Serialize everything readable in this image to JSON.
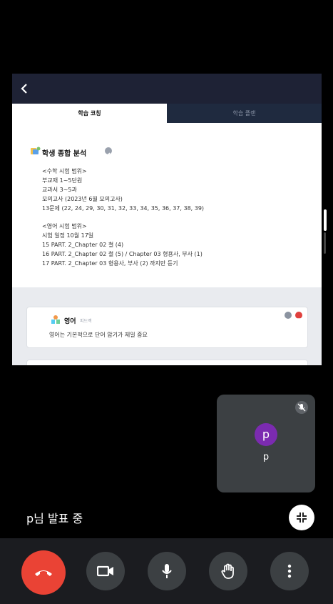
{
  "shared_screen": {
    "tabs": [
      {
        "label": "학습 코칭"
      },
      {
        "label": "학습 플랜"
      }
    ],
    "analysis": {
      "title": "학생 종합 분석",
      "lines": [
        "<수학 시험 범위>",
        "부교재 1~5단원",
        "교과서 3~5과",
        "모의고사 (2023년 6월 모의고사)",
        "13문제 (22, 24, 29, 30, 31, 32, 33, 34, 35, 36, 37, 38, 39)",
        "",
        "<영어 시험 범위>",
        "시험 일정 10월 17일",
        "15 PART. 2_Chapter 02 철 (4)",
        "16 PART. 2_Chapter 02 철 (5) / Chapter 03 형용사, 부사 (1)",
        "17 PART. 2_Chapter 03 형용사, 부사 (2) 까지만 듣기"
      ]
    },
    "feedback_card": {
      "subject": "영어",
      "tag": "피드백",
      "body": "영어는 기본적으로 단어 암기가 제일 중요"
    }
  },
  "self_tile": {
    "avatar_letter": "p",
    "name": "p"
  },
  "presenting_label": "p님 발표 중",
  "icons": {
    "back": "chevron-left-icon",
    "mute": "mic-off-icon",
    "collapse": "collapse-icon",
    "end": "hang-up-icon",
    "camera": "camera-icon",
    "mic": "mic-icon",
    "hand": "raise-hand-icon",
    "more": "more-vert-icon"
  },
  "colors": {
    "end_call": "#ea4335",
    "avatar": "#7b2bb0",
    "topbar": "#1e2235"
  }
}
